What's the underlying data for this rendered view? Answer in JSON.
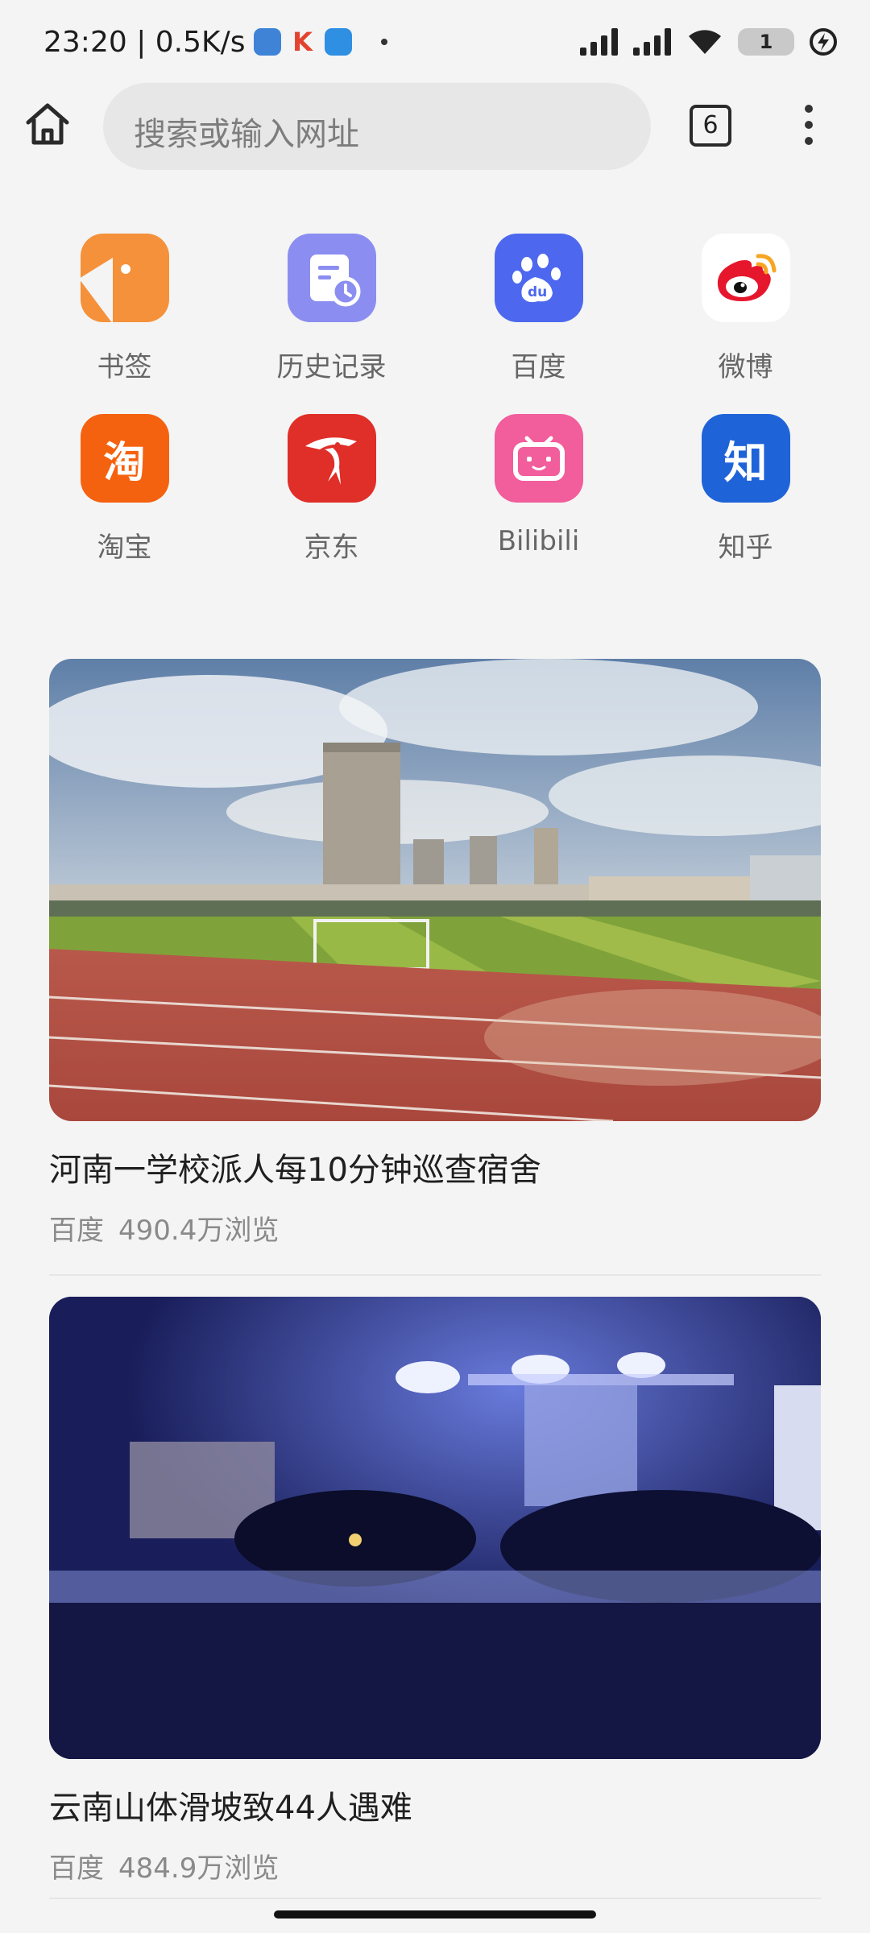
{
  "status_bar": {
    "time_and_speed": "23:20 | 0.5K/s",
    "battery": "1"
  },
  "toolbar": {
    "search_placeholder": "搜索或输入网址",
    "tab_count": "6"
  },
  "shortcuts": [
    {
      "label": "书签",
      "icon": "bookmark-icon",
      "color": "#f5913a"
    },
    {
      "label": "历史记录",
      "icon": "history-icon",
      "color": "#8b8ef0"
    },
    {
      "label": "百度",
      "icon": "baidu-paw-icon",
      "color": "#4d68ee"
    },
    {
      "label": "微博",
      "icon": "weibo-icon",
      "color": "#ffffff"
    },
    {
      "label": "淘宝",
      "icon": "taobao-icon",
      "color": "#f5620f"
    },
    {
      "label": "京东",
      "icon": "jd-icon",
      "color": "#e02e28"
    },
    {
      "label": "Bilibili",
      "icon": "bilibili-tv-icon",
      "color": "#f25d9c"
    },
    {
      "label": "知乎",
      "icon": "zhihu-icon",
      "color": "#1f63d8"
    }
  ],
  "feed": [
    {
      "title": "河南一学校派人每10分钟巡查宿舍",
      "source": "百度",
      "views": "490.4万浏览"
    },
    {
      "title": "云南山体滑坡致44人遇难",
      "source": "百度",
      "views": "484.9万浏览"
    }
  ]
}
